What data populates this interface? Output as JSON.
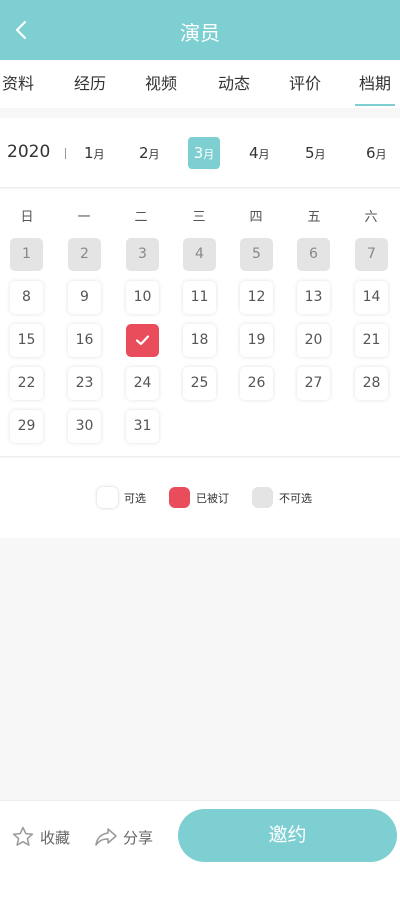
{
  "header": {
    "title": "演员",
    "back_icon": "chevron-left-icon"
  },
  "tabs": [
    {
      "label": "资料",
      "active": false
    },
    {
      "label": "经历",
      "active": false
    },
    {
      "label": "视频",
      "active": false
    },
    {
      "label": "动态",
      "active": false
    },
    {
      "label": "评价",
      "active": false
    },
    {
      "label": "档期",
      "active": true
    }
  ],
  "months": {
    "year": "2020",
    "unit": "月",
    "items": [
      {
        "num": "1",
        "active": false
      },
      {
        "num": "2",
        "active": false
      },
      {
        "num": "3",
        "active": true
      },
      {
        "num": "4",
        "active": false
      },
      {
        "num": "5",
        "active": false
      },
      {
        "num": "6",
        "active": false
      }
    ]
  },
  "calendar": {
    "weekdays": [
      "日",
      "一",
      "二",
      "三",
      "四",
      "五",
      "六"
    ],
    "days": [
      {
        "d": "1",
        "state": "unavailable"
      },
      {
        "d": "2",
        "state": "unavailable"
      },
      {
        "d": "3",
        "state": "unavailable"
      },
      {
        "d": "4",
        "state": "unavailable"
      },
      {
        "d": "5",
        "state": "unavailable"
      },
      {
        "d": "6",
        "state": "unavailable"
      },
      {
        "d": "7",
        "state": "unavailable"
      },
      {
        "d": "8",
        "state": "available"
      },
      {
        "d": "9",
        "state": "available"
      },
      {
        "d": "10",
        "state": "available"
      },
      {
        "d": "11",
        "state": "available"
      },
      {
        "d": "12",
        "state": "available"
      },
      {
        "d": "13",
        "state": "available"
      },
      {
        "d": "14",
        "state": "available"
      },
      {
        "d": "15",
        "state": "available"
      },
      {
        "d": "16",
        "state": "available"
      },
      {
        "d": "17",
        "state": "booked"
      },
      {
        "d": "18",
        "state": "available"
      },
      {
        "d": "19",
        "state": "available"
      },
      {
        "d": "20",
        "state": "available"
      },
      {
        "d": "21",
        "state": "available"
      },
      {
        "d": "22",
        "state": "available"
      },
      {
        "d": "23",
        "state": "available"
      },
      {
        "d": "24",
        "state": "available"
      },
      {
        "d": "25",
        "state": "available"
      },
      {
        "d": "26",
        "state": "available"
      },
      {
        "d": "27",
        "state": "available"
      },
      {
        "d": "28",
        "state": "available"
      },
      {
        "d": "29",
        "state": "available"
      },
      {
        "d": "30",
        "state": "available"
      },
      {
        "d": "31",
        "state": "available"
      }
    ]
  },
  "legend": {
    "available": "可选",
    "booked": "已被订",
    "unavailable": "不可选"
  },
  "footer": {
    "favorite_label": "收藏",
    "favorite_icon": "star-icon",
    "share_label": "分享",
    "share_icon": "share-icon",
    "invite_label": "邀约"
  },
  "colors": {
    "accent": "#7ecfd1",
    "booked": "#e94c5b",
    "unavailable": "#e4e4e4"
  }
}
